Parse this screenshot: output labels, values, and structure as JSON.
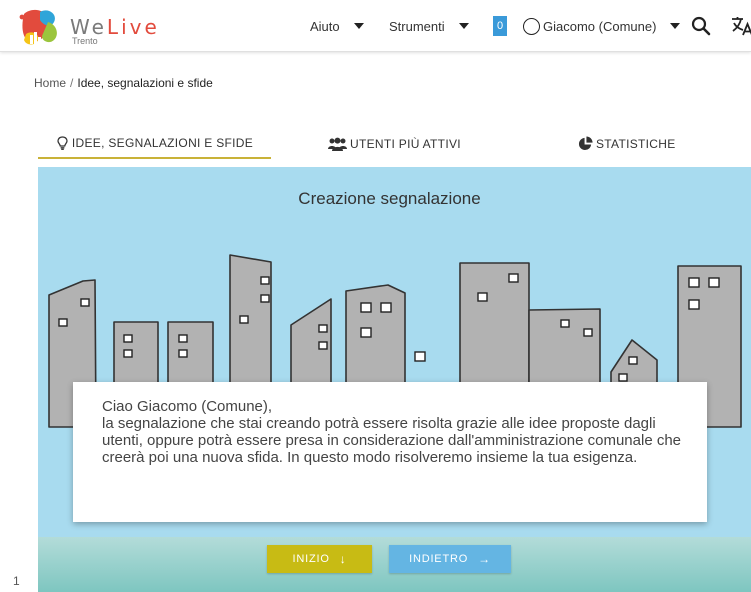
{
  "header": {
    "logo": {
      "word_we": "We",
      "word_live": "Live",
      "subtitle": "Trento"
    },
    "menu": {
      "help": "Aiuto",
      "tools": "Strumenti"
    },
    "notification_count": "0",
    "user_name": "Giacomo (Comune)",
    "icons": {
      "search": "search-icon",
      "translate": "translate-icon",
      "user": "user-circle-icon",
      "dropdown": "chevron-down-icon"
    }
  },
  "breadcrumb": {
    "home": "Home",
    "separator": "/",
    "current": "Idee, segnalazioni e sfide"
  },
  "tabs": [
    {
      "label": "IDEE, SEGNALAZIONI E SFIDE",
      "icon": "lightbulb-icon",
      "active": true
    },
    {
      "label": "UTENTI PIÙ ATTIVI",
      "icon": "users-icon",
      "active": false
    },
    {
      "label": "STATISTICHE",
      "icon": "pie-chart-icon",
      "active": false
    }
  ],
  "hero": {
    "title": "Creazione segnalazione",
    "message": {
      "greeting": "Ciao Giacomo (Comune),",
      "body": "la segnalazione che stai creando potrà essere risolta grazie alle idee proposte dagli utenti, oppure potrà essere presa in considerazione dall'amministrazione comunale che creerà poi una nuova sfida. In questo modo risolveremo insieme la tua esigenza."
    },
    "buttons": {
      "start": "INIZIO",
      "back": "INDIETRO"
    }
  },
  "page_edge_mark": "1",
  "colors": {
    "accent_tab": "#c9b238",
    "start_button": "#c8bb14",
    "back_button": "#64b5e3",
    "badge": "#3a9ad9",
    "sky": "#a8dbef",
    "building": "#b2b2b2",
    "brand_red": "#e24b3d"
  }
}
